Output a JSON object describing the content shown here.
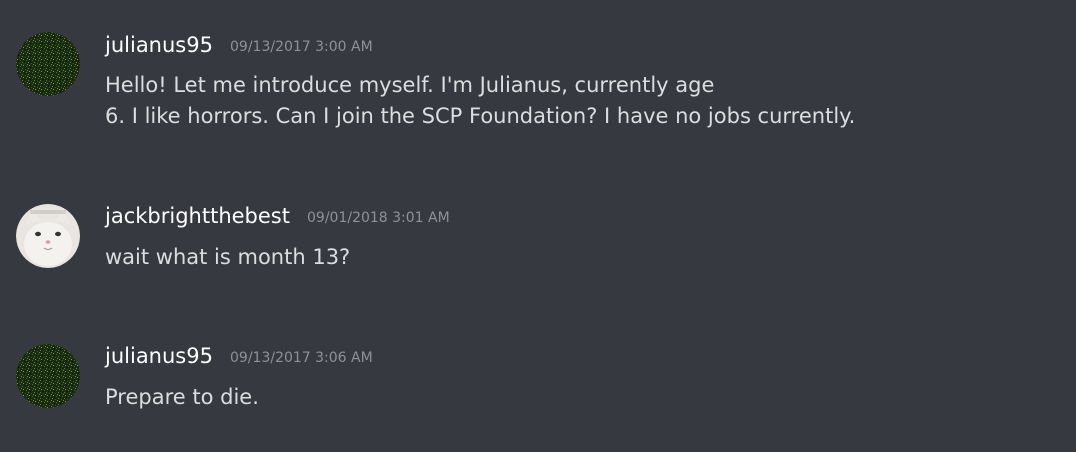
{
  "messages": [
    {
      "author": "julianus95",
      "timestamp": "09/13/2017 3:00 AM",
      "lines": [
        "Hello! Let me introduce myself. I'm Julianus, currently age",
        "6. I like horrors. Can I join the SCP Foundation? I have no jobs currently."
      ],
      "avatar_icon": "dark-green-noise-avatar-icon"
    },
    {
      "author": "jackbrightthebest",
      "timestamp": "09/01/2018 3:01 AM",
      "lines": [
        "wait what is month 13?"
      ],
      "avatar_icon": "white-cat-avatar-icon"
    },
    {
      "author": "julianus95",
      "timestamp": "09/13/2017 3:06 AM",
      "lines": [
        "Prepare to die."
      ],
      "avatar_icon": "dark-green-noise-avatar-icon"
    }
  ],
  "colors": {
    "background": "#36393f",
    "username": "#ffffff",
    "timestamp": "#8e9297",
    "message_text": "#dcddde"
  }
}
